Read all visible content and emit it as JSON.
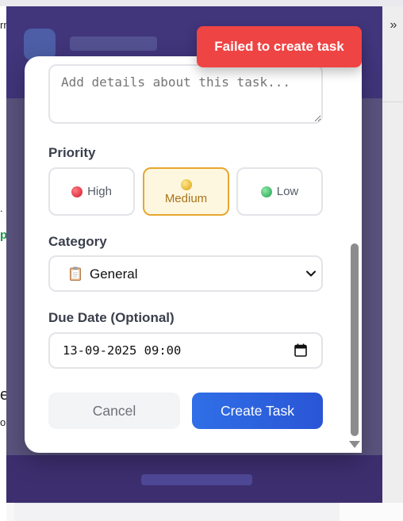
{
  "toast": {
    "message": "Failed to create task"
  },
  "description": {
    "placeholder": "Add details about this task..."
  },
  "priority": {
    "label": "Priority",
    "options": [
      {
        "label": "High",
        "color": "#d11b2b",
        "selected": false
      },
      {
        "label": "Medium",
        "color": "#d9a114",
        "selected": true
      },
      {
        "label": "Low",
        "color": "#1fa24d",
        "selected": false
      }
    ]
  },
  "category": {
    "label": "Category",
    "value": "General",
    "icon": "clipboard-icon"
  },
  "due_date": {
    "label": "Due Date (Optional)",
    "value": "13-09-2025 09:00",
    "icon": "calendar-icon"
  },
  "actions": {
    "cancel": "Cancel",
    "create": "Create Task"
  },
  "toolbar": {
    "overflow_glyph": "»"
  },
  "background_fragments": [
    "rn",
    ".",
    "p",
    "e",
    "o"
  ],
  "colors": {
    "accent": "#2a55d6",
    "danger": "#ef4444",
    "warning": "#e7a730"
  }
}
